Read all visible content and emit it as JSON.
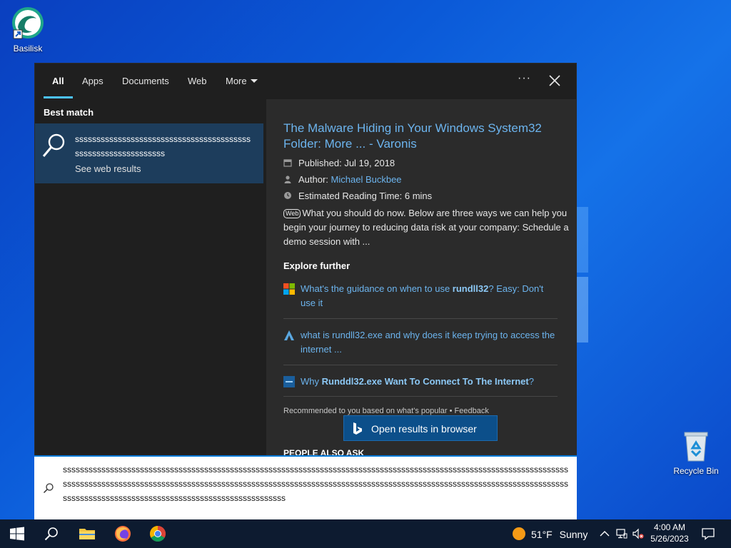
{
  "desktop": {
    "icons": [
      {
        "name": "Basilisk"
      },
      {
        "name": "Recycle Bin"
      }
    ]
  },
  "search_panel": {
    "tabs": [
      "All",
      "Apps",
      "Documents",
      "Web",
      "More"
    ],
    "active_tab": "All",
    "best_match_heading": "Best match",
    "best_match": {
      "query": "ssssssssssssssssssssssssssssssssssssssssssssssssssssssssssssss",
      "subtitle": "See web results"
    },
    "result": {
      "title": "The Malware Hiding in Your Windows System32 Folder: More ... - Varonis",
      "published": "Published: Jul 19, 2018",
      "author_label": "Author: ",
      "author_name": "Michael Buckbee",
      "reading_time": "Estimated Reading Time: 6 mins",
      "web_badge": "Web",
      "snippet": "What you should do now. Below are three ways we can help you begin your journey to reducing data risk at your company: Schedule a demo session with ..."
    },
    "explore_heading": "Explore further",
    "explore": [
      {
        "pre": "What's the guidance on when to use ",
        "bold": "rundll32",
        "post": "? Easy: Don't use it",
        "icon": "microsoft-icon"
      },
      {
        "pre": "what is rundll32.exe and why does it keep trying to access the internet ...",
        "bold": "",
        "post": "",
        "icon": "a-icon"
      },
      {
        "pre": "Why ",
        "bold": "Runddl32.exe Want To Connect To The Internet",
        "post": "?",
        "icon": "site-icon"
      }
    ],
    "recommended_text": "Recommended to you based on what's popular • Feedback",
    "open_button": "Open results in browser",
    "people_also_ask": "PEOPLE ALSO ASK"
  },
  "search_box": {
    "value": "ssssssssssssssssssssssssssssssssssssssssssssssssssssssssssssssssssssssssssssssssssssssssssssssssssssssssssssssssssssssssssssssssssssssssssssssssssssssssssssssssssssssssssssssssssssssssssssssssssssssssssssssssssssssssssssssssssssssssssssssssssssssssssssssssssssssssssssssssssssssssssssssss"
  },
  "taskbar": {
    "weather_temp": "51°F",
    "weather_text": "Sunny",
    "time": "4:00 AM",
    "date": "5/26/2023"
  },
  "colors": {
    "accent": "#0078d7",
    "link": "#6cb4ee",
    "panel_bg": "#1f1f1f",
    "right_bg": "#2b2b2b",
    "selected_bg": "#1d3d5c"
  }
}
